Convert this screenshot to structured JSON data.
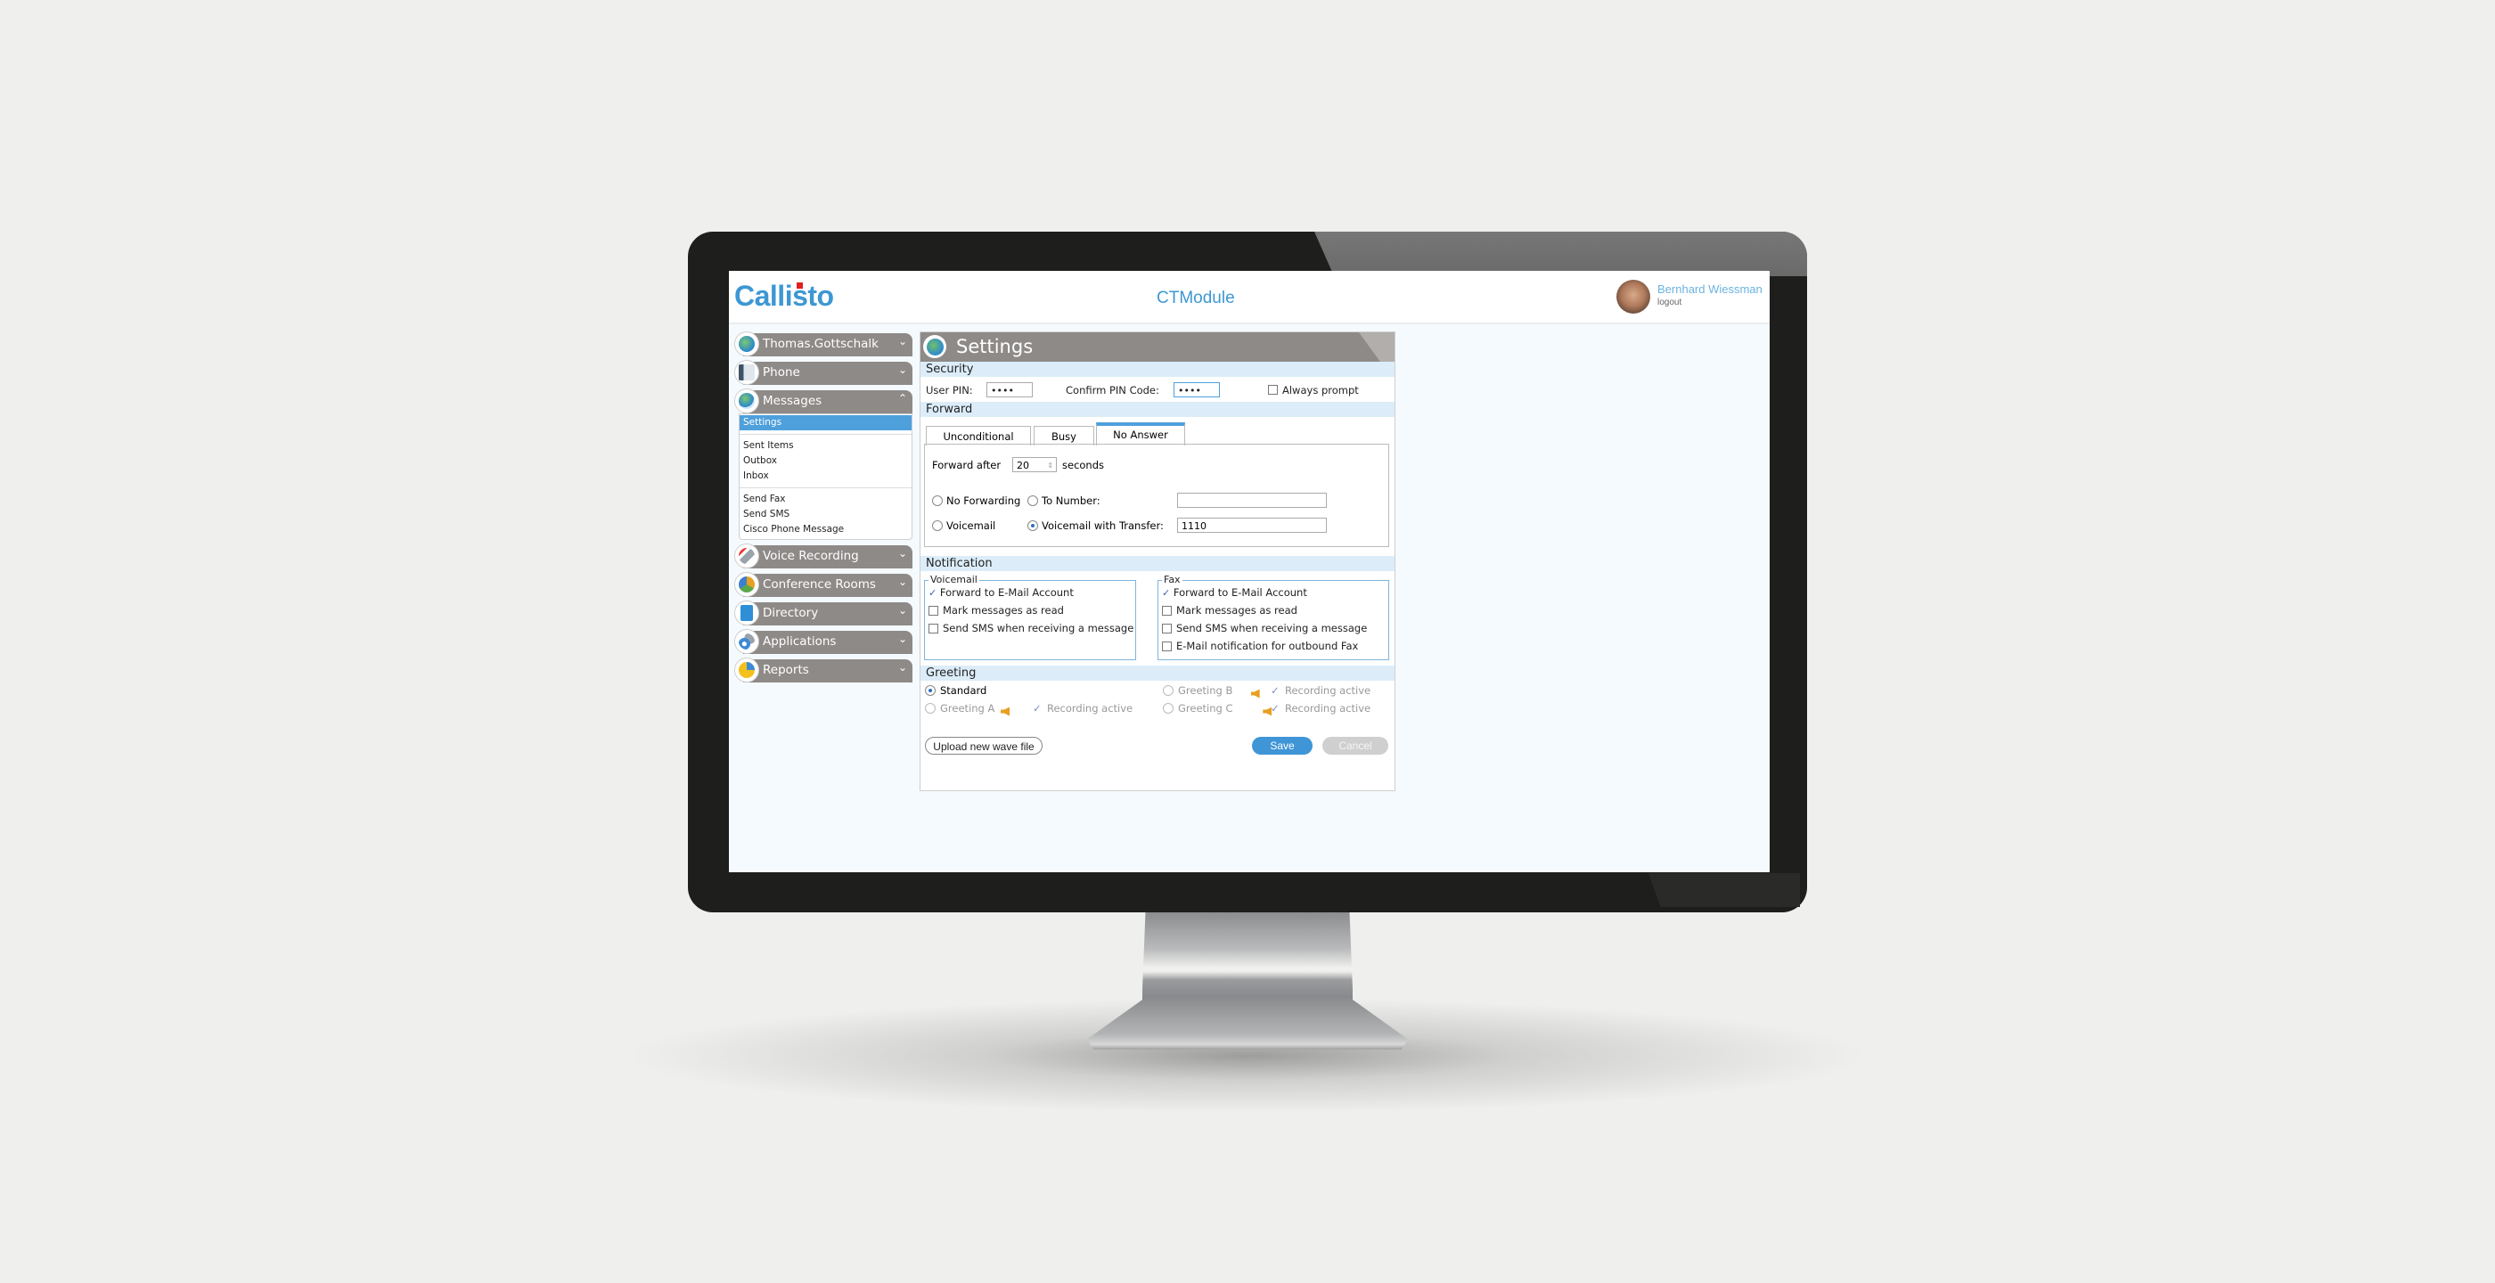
{
  "app": {
    "logo": "Callisto",
    "module": "CTModule"
  },
  "user": {
    "name": "Bernhard Wiessman",
    "logout_label": "logout"
  },
  "sidebar": {
    "items": [
      {
        "label": "Thomas.Gottschalk",
        "icon": "globe-icon",
        "expanded": false
      },
      {
        "label": "Phone",
        "icon": "desk-phone-icon",
        "expanded": false
      },
      {
        "label": "Messages",
        "icon": "globe-envelope-icon",
        "expanded": true
      },
      {
        "label": "Voice Recording",
        "icon": "microphone-icon",
        "expanded": false
      },
      {
        "label": "Conference Rooms",
        "icon": "people-icon",
        "expanded": false
      },
      {
        "label": "Directory",
        "icon": "address-book-icon",
        "expanded": false
      },
      {
        "label": "Applications",
        "icon": "gears-icon",
        "expanded": false
      },
      {
        "label": "Reports",
        "icon": "pie-chart-icon",
        "expanded": false
      }
    ],
    "messages_submenu": {
      "selected": "Settings",
      "group1": [
        "Settings"
      ],
      "group2": [
        "Sent Items",
        "Outbox",
        "Inbox"
      ],
      "group3": [
        "Send Fax",
        "Send SMS",
        "Cisco Phone Message"
      ]
    }
  },
  "panel": {
    "title": "Settings",
    "security": {
      "heading": "Security",
      "user_pin_label": "User PIN:",
      "user_pin_value": "••••",
      "confirm_pin_label": "Confirm PIN Code:",
      "confirm_pin_value": "••••",
      "always_prompt_label": "Always prompt",
      "always_prompt_checked": false
    },
    "forward": {
      "heading": "Forward",
      "tabs": [
        "Unconditional",
        "Busy",
        "No Answer"
      ],
      "active_tab": "No Answer",
      "forward_after_label": "Forward after",
      "forward_after_value": "20",
      "seconds_label": "seconds",
      "options": {
        "no_forwarding": "No Forwarding",
        "to_number": "To Number:",
        "voicemail": "Voicemail",
        "voicemail_transfer": "Voicemail with Transfer:"
      },
      "selected_option": "Voicemail with Transfer:",
      "to_number_value": "",
      "transfer_value": "1110"
    },
    "notification": {
      "heading": "Notification",
      "voicemail": {
        "legend": "Voicemail",
        "items": [
          {
            "label": "Forward to E-Mail Account",
            "checked": true
          },
          {
            "label": "Mark messages as read",
            "checked": false
          },
          {
            "label": "Send SMS when receiving a message",
            "checked": false
          }
        ]
      },
      "fax": {
        "legend": "Fax",
        "items": [
          {
            "label": "Forward to E-Mail Account",
            "checked": true
          },
          {
            "label": "Mark messages as read",
            "checked": false
          },
          {
            "label": "Send SMS when receiving a message",
            "checked": false
          },
          {
            "label": "E-Mail notification for outbound Fax",
            "checked": false
          }
        ]
      }
    },
    "greeting": {
      "heading": "Greeting",
      "standard": "Standard",
      "selected": "Standard",
      "greeting_a": "Greeting A",
      "greeting_b": "Greeting B",
      "greeting_c": "Greeting C",
      "recording_active": "Recording active"
    },
    "buttons": {
      "upload": "Upload new wave file",
      "save": "Save",
      "cancel": "Cancel"
    }
  },
  "colors": {
    "accent": "#3d97d3",
    "header_grey": "#8e8a88",
    "section_bg": "#dcedf9",
    "selected": "#4ea0dc"
  }
}
